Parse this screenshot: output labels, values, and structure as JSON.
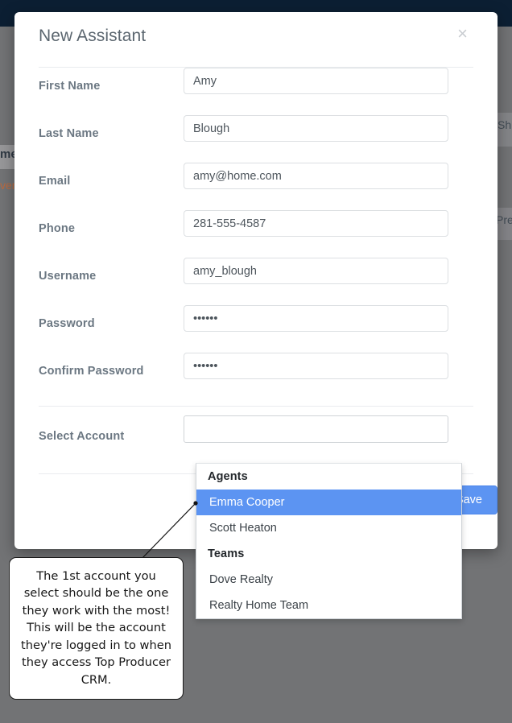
{
  "background": {
    "topbar_color": "#0c1f33",
    "overlay_color": "#727375",
    "left_tab_label": "me",
    "left_link_label": "ven",
    "right_label_1": "Sh",
    "right_label_2": "Pre"
  },
  "modal": {
    "title": "New Assistant",
    "close_label": "×",
    "submit_label": "Save",
    "fields": [
      {
        "label": "First Name",
        "value": "Amy",
        "placeholder": "",
        "type": "text",
        "name": "first-name"
      },
      {
        "label": "Last Name",
        "value": "Blough",
        "placeholder": "",
        "type": "text",
        "name": "last-name"
      },
      {
        "label": "Email",
        "value": "amy@home.com",
        "placeholder": "",
        "type": "text",
        "name": "email"
      },
      {
        "label": "Phone",
        "value": "281-555-4587",
        "placeholder": "",
        "type": "text",
        "name": "phone"
      },
      {
        "label": "Username",
        "value": "amy_blough",
        "placeholder": "",
        "type": "text",
        "name": "username"
      },
      {
        "label": "Password",
        "value": "123456",
        "placeholder": "",
        "type": "password",
        "name": "password"
      },
      {
        "label": "Confirm Password",
        "value": "123456",
        "placeholder": "",
        "type": "password",
        "name": "confirm-password"
      }
    ],
    "select_account": {
      "label": "Select Account",
      "value": "",
      "placeholder": "",
      "groups": [
        {
          "label": "Agents",
          "options": [
            {
              "label": "Emma Cooper",
              "selected": true
            },
            {
              "label": "Scott Heaton",
              "selected": false
            }
          ]
        },
        {
          "label": "Teams",
          "options": [
            {
              "label": "Dove Realty",
              "selected": false
            },
            {
              "label": "Realty Home Team",
              "selected": false
            }
          ]
        }
      ],
      "highlight_color": "#5c94f2"
    }
  },
  "callout": {
    "text": "The 1st account you select should be the one they work with the most! This will be the account they're logged in to when they access Top Producer CRM."
  }
}
